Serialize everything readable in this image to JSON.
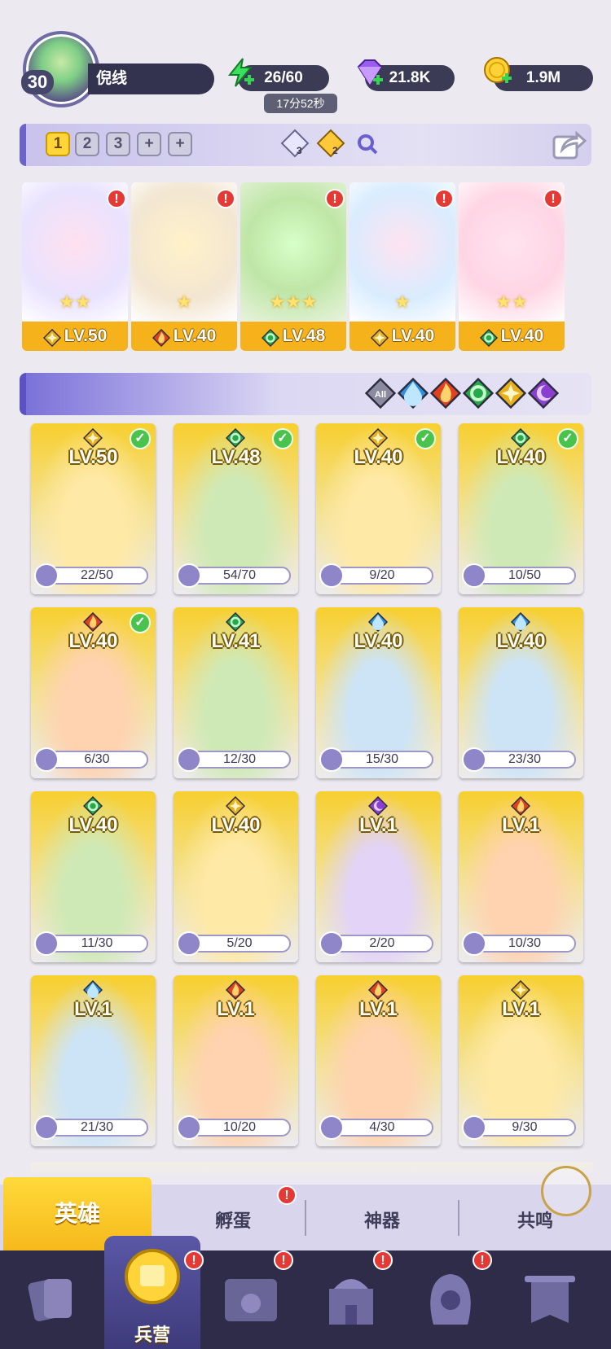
{
  "player": {
    "level": "30",
    "name": "倪线"
  },
  "resources": {
    "energy": "26/60",
    "energy_timer": "17分52秒",
    "gems": "21.8K",
    "gold": "1.9M"
  },
  "team_tabs": [
    "1",
    "2",
    "3",
    "+",
    "+"
  ],
  "team_counters": {
    "diamond_a": "3",
    "diamond_b": "2"
  },
  "team_slots": [
    {
      "element": "light",
      "level": "LV.50",
      "stars": 2,
      "alert": "!"
    },
    {
      "element": "fire",
      "level": "LV.40",
      "stars": 1,
      "alert": "!"
    },
    {
      "element": "nature",
      "level": "LV.48",
      "stars": 3,
      "alert": "!"
    },
    {
      "element": "light",
      "level": "LV.40",
      "stars": 1,
      "alert": "!"
    },
    {
      "element": "nature",
      "level": "LV.40",
      "stars": 2,
      "alert": "!"
    }
  ],
  "filters": [
    "All",
    "water",
    "fire",
    "nature",
    "light",
    "dark"
  ],
  "colors": {
    "water": "#2f8fe0",
    "fire": "#e2411f",
    "nature": "#27a84a",
    "light": "#e8b01c",
    "dark": "#8a3fd1",
    "accent": "#f6b21a"
  },
  "heroes": [
    {
      "element": "light",
      "level": "LV.50",
      "shards": "22/50",
      "in_team": true
    },
    {
      "element": "nature",
      "level": "LV.48",
      "shards": "54/70",
      "in_team": true
    },
    {
      "element": "light",
      "level": "LV.40",
      "shards": "9/20",
      "in_team": true
    },
    {
      "element": "nature",
      "level": "LV.40",
      "shards": "10/50",
      "in_team": true
    },
    {
      "element": "fire",
      "level": "LV.40",
      "shards": "6/30",
      "in_team": true
    },
    {
      "element": "nature",
      "level": "LV.41",
      "shards": "12/30",
      "in_team": false
    },
    {
      "element": "water",
      "level": "LV.40",
      "shards": "15/30",
      "in_team": false
    },
    {
      "element": "water",
      "level": "LV.40",
      "shards": "23/30",
      "in_team": false
    },
    {
      "element": "nature",
      "level": "LV.40",
      "shards": "11/30",
      "in_team": false
    },
    {
      "element": "light",
      "level": "LV.40",
      "shards": "5/20",
      "in_team": false
    },
    {
      "element": "dark",
      "level": "LV.1",
      "shards": "2/20",
      "in_team": false
    },
    {
      "element": "fire",
      "level": "LV.1",
      "shards": "10/30",
      "in_team": false
    },
    {
      "element": "water",
      "level": "LV.1",
      "shards": "21/30",
      "in_team": false
    },
    {
      "element": "fire",
      "level": "LV.1",
      "shards": "10/20",
      "in_team": false
    },
    {
      "element": "fire",
      "level": "LV.1",
      "shards": "4/30",
      "in_team": false
    },
    {
      "element": "light",
      "level": "LV.1",
      "shards": "9/30",
      "in_team": false
    }
  ],
  "sub_tabs": [
    {
      "label": "英雄",
      "active": true
    },
    {
      "label": "孵蛋",
      "alert": "!"
    },
    {
      "label": "神器"
    },
    {
      "label": "共鸣"
    }
  ],
  "bottom_nav": [
    {
      "icon": "cards-icon"
    },
    {
      "icon": "barracks-icon",
      "label": "兵营",
      "active": true,
      "alert": "!"
    },
    {
      "icon": "map-icon",
      "alert": "!"
    },
    {
      "icon": "castle-icon",
      "alert": "!"
    },
    {
      "icon": "hooded-figure-icon",
      "alert": "!"
    },
    {
      "icon": "banner-icon"
    }
  ]
}
